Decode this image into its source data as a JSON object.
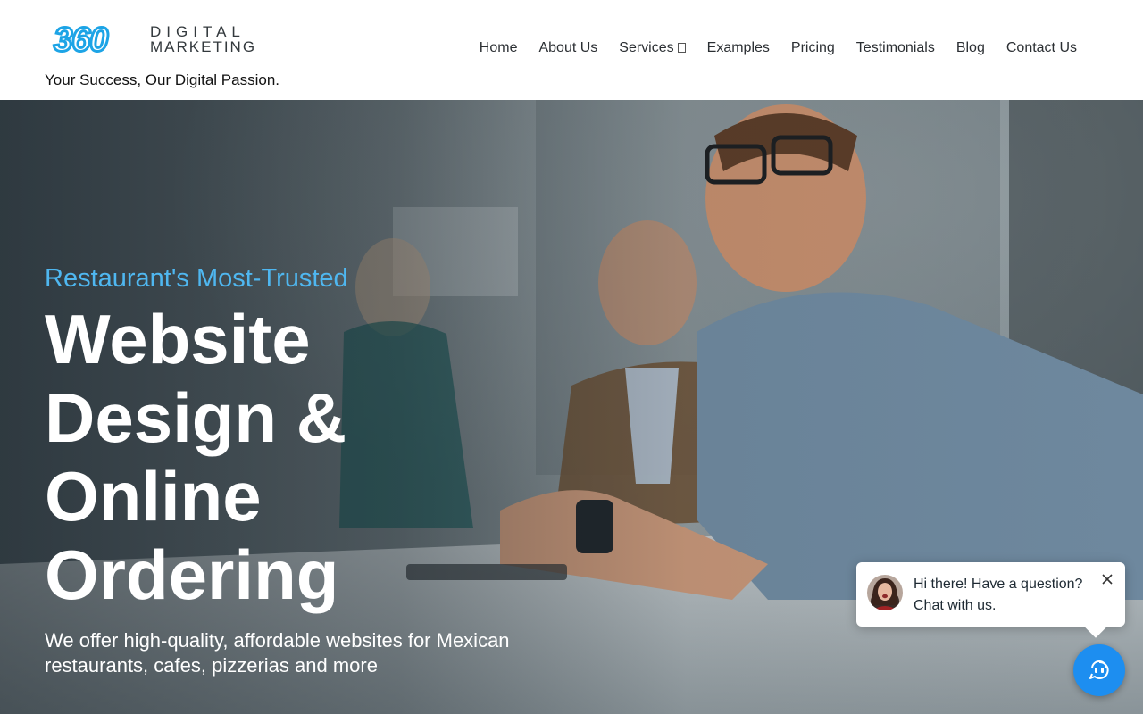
{
  "brand": {
    "logo_number": "360",
    "logo_word_top": "DIGITAL",
    "logo_word_bottom": "MARKETING",
    "tagline": "Your Success, Our Digital Passion.",
    "accent_color": "#1da4e6"
  },
  "nav": {
    "items": [
      {
        "label": "Home"
      },
      {
        "label": "About Us"
      },
      {
        "label": "Services",
        "has_dropdown": true
      },
      {
        "label": "Examples"
      },
      {
        "label": "Pricing"
      },
      {
        "label": "Testimonials"
      },
      {
        "label": "Blog"
      },
      {
        "label": "Contact Us"
      }
    ]
  },
  "hero": {
    "eyebrow": "Restaurant's Most-Trusted",
    "title_lines": [
      "Website",
      "Design &",
      "Online",
      "Ordering"
    ],
    "description": "We offer high-quality, affordable websites for Mexican restaurants, cafes, pizzerias and more",
    "eyebrow_color": "#4fb7f0"
  },
  "chat": {
    "message": "Hi there! Have a question? Chat with us.",
    "close_icon": "close-icon",
    "launcher_icon": "chat-icon",
    "launcher_color": "#1d8ef0"
  }
}
